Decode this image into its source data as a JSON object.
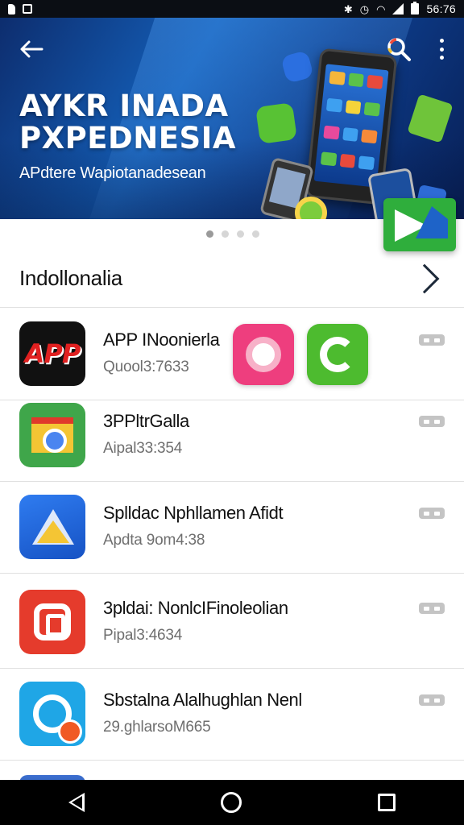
{
  "status_bar": {
    "time": "56:76",
    "icons": [
      "sim-icon",
      "image-icon",
      "bluetooth-icon",
      "alarm-icon",
      "wifi-icon",
      "signal-icon",
      "battery-icon"
    ]
  },
  "banner": {
    "title_line1": "AYKR INADA",
    "title_line2": "PXPEDNESIA",
    "subtitle": "APdtere Wapiotanadesean",
    "carousel": {
      "count": 4,
      "active": 0
    }
  },
  "section": {
    "title": "Indollonalia"
  },
  "apps": [
    {
      "name": "APP INoonierla",
      "meta": "Quool3:7633",
      "icon": "app-logo-icon",
      "icon_text": "APP"
    },
    {
      "name": "3PPltrGalla",
      "meta": "Aipal33:354",
      "icon": "chrome-mail-icon"
    },
    {
      "name": "Splldac Nphllamen Afidt",
      "meta": "Apdta 9om4:38",
      "icon": "drive-triangle-icon"
    },
    {
      "name": "3pldai: NonlcIFinoleolian",
      "meta": "Pipal3:4634",
      "icon": "red-square-icon"
    },
    {
      "name": "Sbstalna Alalhughlan Nenl",
      "meta": "29.ghlarsoM665",
      "icon": "cyan-ring-icon"
    }
  ],
  "colors": {
    "banner_gradient": [
      "#0d2d6e",
      "#145fb8",
      "#081f55"
    ],
    "status_bar": "#0b0e14",
    "nav_bar": "#000000",
    "divider": "#e0e0e0",
    "meta_text": "#6f6f6f"
  }
}
